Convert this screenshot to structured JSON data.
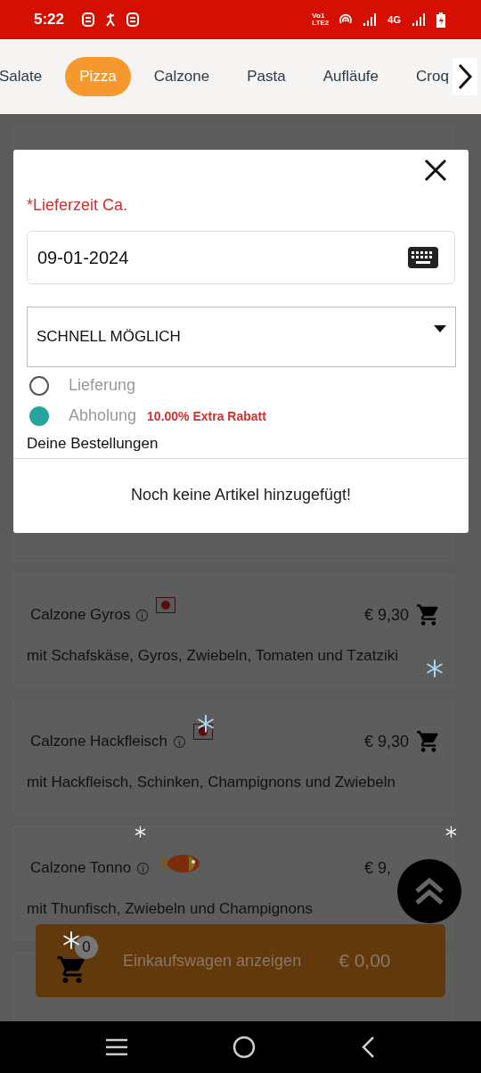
{
  "status_bar": {
    "time": "5:22",
    "volte": [
      "Vo1",
      "LTE2"
    ],
    "network": "4G"
  },
  "tabs": [
    {
      "label": "Salate",
      "selected": false
    },
    {
      "label": "Pizza",
      "selected": true
    },
    {
      "label": "Calzone",
      "selected": false
    },
    {
      "label": "Pasta",
      "selected": false
    },
    {
      "label": "Aufläufe",
      "selected": false
    },
    {
      "label": "Croq",
      "selected": false
    }
  ],
  "dialog": {
    "delivery_label": "*Lieferzeit Ca.",
    "date": "09-01-2024",
    "time_select": "SCHNELL MÖGLICH",
    "options": [
      {
        "label": "Lieferung",
        "selected": false
      },
      {
        "label": "Abholung",
        "selected": true,
        "note": "10.00% Extra Rabatt"
      }
    ],
    "orders_heading": "Deine Bestellungen",
    "empty_message": "Noch keine Artikel hinzugefügt!"
  },
  "products": [
    {
      "name": "Calzone Gyros",
      "kind": "dot",
      "price": "€ 9,30",
      "description": "mit Schafskäse, Gyros, Zwiebeln, Tomaten und Tzatziki"
    },
    {
      "name": "Calzone Hackfleisch",
      "kind": "dot",
      "price": "€ 9,30",
      "description": "mit Hackfleisch, Schinken, Champignons und Zwiebeln"
    },
    {
      "name": "Calzone Tonno",
      "kind": "fish",
      "price": "€ 9,",
      "description": "mit Thunfisch, Zwiebeln und Champignons"
    }
  ],
  "cart_bar": {
    "count": "0",
    "label": "Einkaufswagen anzeigen",
    "total": "€ 0,00"
  }
}
